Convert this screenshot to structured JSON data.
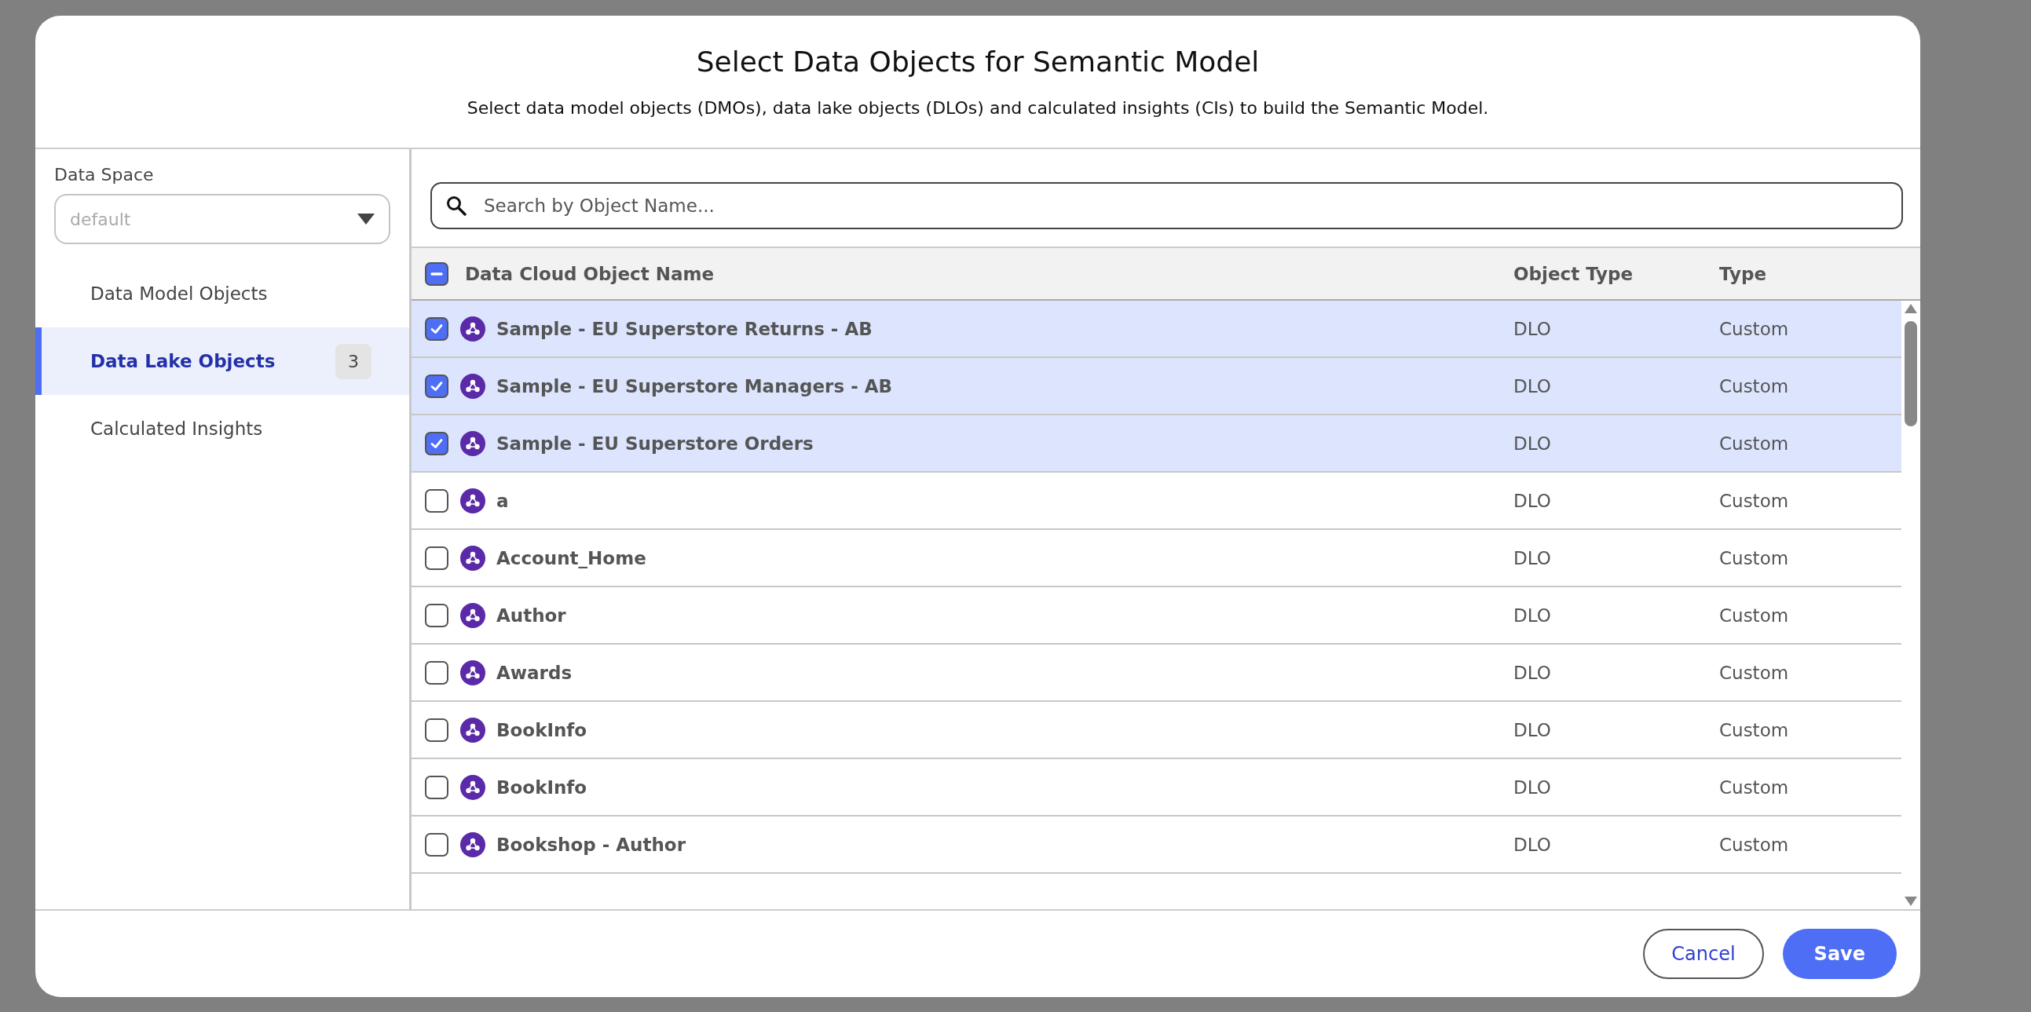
{
  "dialog": {
    "title": "Select Data Objects for Semantic Model",
    "subtitle": "Select data model objects (DMOs), data lake objects (DLOs) and calculated insights (CIs) to build the Semantic Model."
  },
  "data_space": {
    "label": "Data Space",
    "placeholder": "default"
  },
  "sidebar": {
    "items": [
      {
        "label": "Data Model Objects",
        "selected": false
      },
      {
        "label": "Data Lake Objects",
        "selected": true,
        "count": "3"
      },
      {
        "label": "Calculated Insights",
        "selected": false
      }
    ]
  },
  "search": {
    "placeholder": "Search by Object Name..."
  },
  "table": {
    "select_all": {
      "indeterminate": true
    },
    "columns": [
      "Data Cloud Object Name",
      "Object Type",
      "Type"
    ],
    "rows": [
      {
        "name": "Sample - EU Superstore Returns - AB",
        "object_type": "DLO",
        "type": "Custom",
        "checked": true
      },
      {
        "name": "Sample - EU Superstore Managers - AB",
        "object_type": "DLO",
        "type": "Custom",
        "checked": true
      },
      {
        "name": "Sample - EU Superstore Orders",
        "object_type": "DLO",
        "type": "Custom",
        "checked": true
      },
      {
        "name": "a",
        "object_type": "DLO",
        "type": "Custom",
        "checked": false
      },
      {
        "name": "Account_Home",
        "object_type": "DLO",
        "type": "Custom",
        "checked": false
      },
      {
        "name": "Author",
        "object_type": "DLO",
        "type": "Custom",
        "checked": false
      },
      {
        "name": "Awards",
        "object_type": "DLO",
        "type": "Custom",
        "checked": false
      },
      {
        "name": "BookInfo",
        "object_type": "DLO",
        "type": "Custom",
        "checked": false
      },
      {
        "name": "BookInfo",
        "object_type": "DLO",
        "type": "Custom",
        "checked": false
      },
      {
        "name": "Bookshop - Author",
        "object_type": "DLO",
        "type": "Custom",
        "checked": false
      }
    ]
  },
  "buttons": [
    {
      "label": "Cancel",
      "kind": "secondary"
    },
    {
      "label": "Save",
      "kind": "primary"
    }
  ]
}
